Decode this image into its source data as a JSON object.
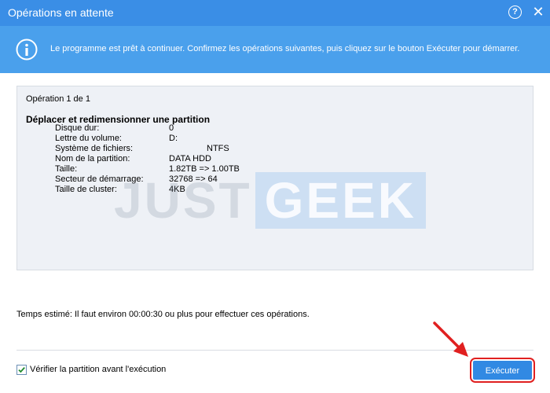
{
  "window": {
    "title": "Opérations en attente",
    "help_label": "?",
    "close_label": "✕"
  },
  "banner": {
    "icon": "info-icon",
    "message": "Le programme est prêt à continuer. Confirmez les opérations suivantes, puis cliquez sur le bouton Exécuter pour démarrer."
  },
  "operation": {
    "counter": "Opération 1 de 1",
    "title": "Déplacer et redimensionner une partition",
    "details": [
      {
        "label": "Disque dur:",
        "value": "0"
      },
      {
        "label": "Lettre du volume:",
        "value": "D:"
      },
      {
        "label": "Système de fichiers:",
        "value": "NTFS"
      },
      {
        "label": "Nom de la partition:",
        "value": "DATA HDD"
      },
      {
        "label": "Taille:",
        "value": "1.82TB => 1.00TB"
      },
      {
        "label": "Secteur de démarrage:",
        "value": "32768 => 64"
      },
      {
        "label": "Taille de cluster:",
        "value": "4KB"
      }
    ]
  },
  "watermark": {
    "part1": "JUST",
    "part2": "GEEK"
  },
  "estimate": "Temps estimé: Il faut environ 00:00:30 ou plus pour effectuer ces opérations.",
  "verify": {
    "label": "Vérifier la partition avant l'exécution",
    "checked": true
  },
  "execute_label": "Exécuter",
  "colors": {
    "titlebar": "#3a8ee6",
    "banner": "#4aa0ec",
    "button": "#3189e3",
    "highlight": "#e02020"
  }
}
